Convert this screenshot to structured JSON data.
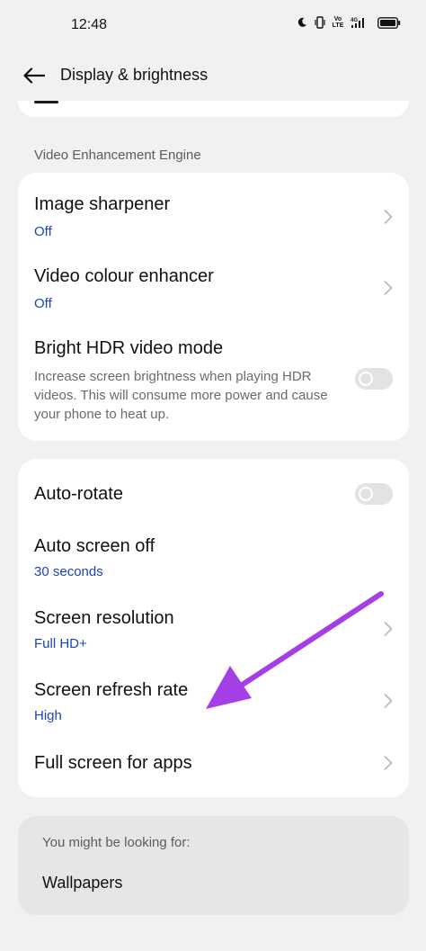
{
  "status_bar": {
    "time": "12:48",
    "icons": [
      "moon-icon",
      "vibrate-icon",
      "volte-icon",
      "4g-signal-icon",
      "battery-icon"
    ],
    "volte_text": "Vo\nLTE",
    "network_text": "4G"
  },
  "header": {
    "title": "Display & brightness"
  },
  "section_video": {
    "label": "Video Enhancement Engine",
    "items": [
      {
        "title": "Image sharpener",
        "value": "Off"
      },
      {
        "title": "Video colour enhancer",
        "value": "Off"
      },
      {
        "title": "Bright HDR video mode",
        "description": "Increase screen brightness when playing HDR videos. This will consume more power and cause your phone to heat up.",
        "enabled": false
      }
    ]
  },
  "section_screen": {
    "items": [
      {
        "title": "Auto-rotate",
        "enabled": false
      },
      {
        "title": "Auto screen off",
        "value": "30 seconds"
      },
      {
        "title": "Screen resolution",
        "value": "Full HD+"
      },
      {
        "title": "Screen refresh rate",
        "value": "High"
      },
      {
        "title": "Full screen for apps"
      }
    ]
  },
  "suggestions": {
    "label": "You might be looking for:",
    "items": [
      "Wallpapers"
    ]
  },
  "colors": {
    "accent_value": "#1c46b5",
    "annotation_arrow": "#a43ee6",
    "background": "#f1f1f1",
    "card": "#ffffff"
  }
}
